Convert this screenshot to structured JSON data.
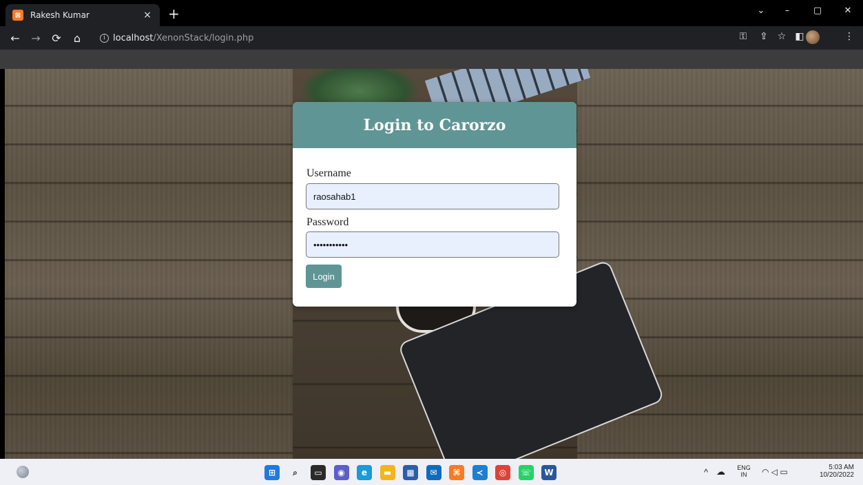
{
  "browser": {
    "tab_title": "Rakesh Kumar",
    "tab_close": "×",
    "new_tab": "+",
    "url_host": "localhost",
    "url_path": "/XenonStack/login.php",
    "controls": {
      "chevron": "⌄",
      "minimize": "–",
      "restore": "▢",
      "close": "✕"
    },
    "nav": {
      "back": "←",
      "forward": "→",
      "reload": "⟳",
      "home": "⌂"
    },
    "right_icons": {
      "key": "⚿",
      "share": "⇪",
      "star": "☆",
      "sidebar": "◧",
      "menu": "⋮"
    }
  },
  "login": {
    "title": "Login to Carorzo",
    "username_label": "Username",
    "username_value": "raosahab1",
    "password_label": "Password",
    "password_value": "•••••••••••",
    "button_label": "Login"
  },
  "taskbar": {
    "apps": [
      {
        "name": "windows-start-icon",
        "color": "#1f7ae0",
        "glyph": "⊞"
      },
      {
        "name": "search-icon",
        "color": "transparent",
        "glyph": "⌕"
      },
      {
        "name": "task-view-icon",
        "color": "#2a2a2a",
        "glyph": "▭"
      },
      {
        "name": "teams-chat-icon",
        "color": "#5b5fc7",
        "glyph": "◉"
      },
      {
        "name": "edge-icon",
        "color": "#1a9ad6",
        "glyph": "e"
      },
      {
        "name": "file-explorer-icon",
        "color": "#f3b51c",
        "glyph": "▬"
      },
      {
        "name": "store-icon",
        "color": "#2c5ea8",
        "glyph": "▦"
      },
      {
        "name": "mail-icon",
        "color": "#0f6cbd",
        "glyph": "✉"
      },
      {
        "name": "xampp-icon",
        "color": "#fb7a24",
        "glyph": "⌘"
      },
      {
        "name": "vscode-icon",
        "color": "#1e7fd0",
        "glyph": "≺"
      },
      {
        "name": "chrome-icon",
        "color": "#db4437",
        "glyph": "◎"
      },
      {
        "name": "whatsapp-icon",
        "color": "#25d366",
        "glyph": "☏"
      },
      {
        "name": "word-icon",
        "color": "#2b579a",
        "glyph": "W"
      }
    ],
    "lang_top": "ENG",
    "lang_bottom": "IN",
    "time": "5:03 AM",
    "date": "10/20/2022",
    "tray_chevron": "^",
    "tray_icons": "☁",
    "status_icons": "◠ ◁ ▭"
  }
}
